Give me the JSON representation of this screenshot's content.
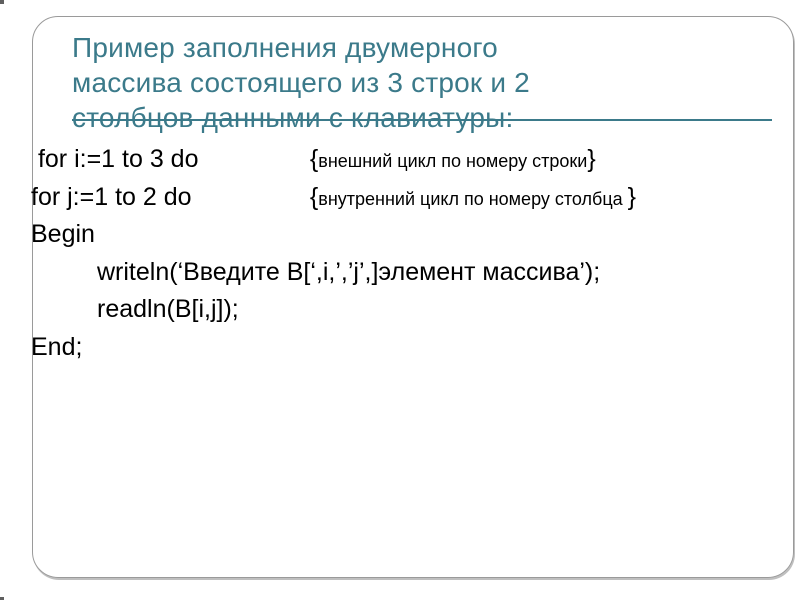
{
  "title": {
    "line1": "Пример заполнения двумерного",
    "line2": "массива состоящего из 3 строк и 2",
    "line3": "столбцов данными с клавиатуры:"
  },
  "code": {
    "for_i": "for i:=1 to 3 do",
    "for_i_comment_inner": "внешний цикл по номеру строки",
    "for_j": "for  j:=1 to 2 do",
    "for_j_comment_inner": "внутренний цикл по номеру столбца ",
    "begin": "Begin",
    "writeln": "writeln(‘Введите B[‘,i,’,’j’,]элемент массива’);",
    "readln": "readln(B[i,j]);",
    "end": "End;"
  },
  "braces": {
    "open": "{",
    "close": "}"
  }
}
